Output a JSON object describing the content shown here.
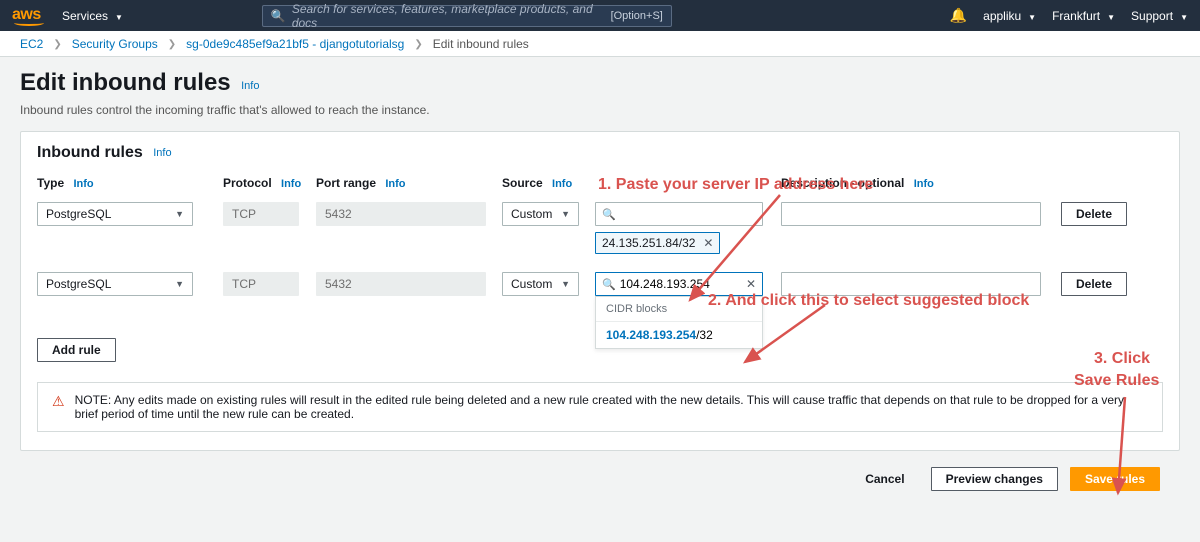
{
  "nav": {
    "logo": "aws",
    "services": "Services",
    "search_placeholder": "Search for services, features, marketplace products, and docs",
    "shortcut": "[Option+S]",
    "account": "appliku",
    "region": "Frankfurt",
    "support": "Support"
  },
  "breadcrumb": {
    "items": [
      "EC2",
      "Security Groups",
      "sg-0de9c485ef9a21bf5 - djangotutorialsg"
    ],
    "current": "Edit inbound rules"
  },
  "header": {
    "title": "Edit inbound rules",
    "info": "Info",
    "subtitle": "Inbound rules control the incoming traffic that's allowed to reach the instance."
  },
  "panel": {
    "title": "Inbound rules",
    "info": "Info",
    "columns": {
      "type": "Type",
      "protocol": "Protocol",
      "port": "Port range",
      "source": "Source",
      "description": "Description - optional"
    },
    "rules": [
      {
        "type": "PostgreSQL",
        "protocol": "TCP",
        "port": "5432",
        "source_mode": "Custom",
        "source_search": "",
        "chip": "24.135.251.84/32",
        "description": ""
      },
      {
        "type": "PostgreSQL",
        "protocol": "TCP",
        "port": "5432",
        "source_mode": "Custom",
        "source_search": "104.248.193.254",
        "description": ""
      }
    ],
    "suggestion": {
      "heading": "CIDR blocks",
      "ip": "104.248.193.254",
      "mask": "/32"
    },
    "add_rule": "Add rule",
    "delete": "Delete",
    "warning": "NOTE: Any edits made on existing rules will result in the edited rule being deleted and a new rule created with the new details. This will cause traffic that depends on that rule to be dropped for a very brief period of time until the new rule can be created."
  },
  "footer": {
    "cancel": "Cancel",
    "preview": "Preview changes",
    "save": "Save rules"
  },
  "annotations": {
    "a1": "1. Paste your server IP address here",
    "a2": "2. And click this to select suggested block",
    "a3a": "3. Click",
    "a3b": "Save Rules"
  }
}
